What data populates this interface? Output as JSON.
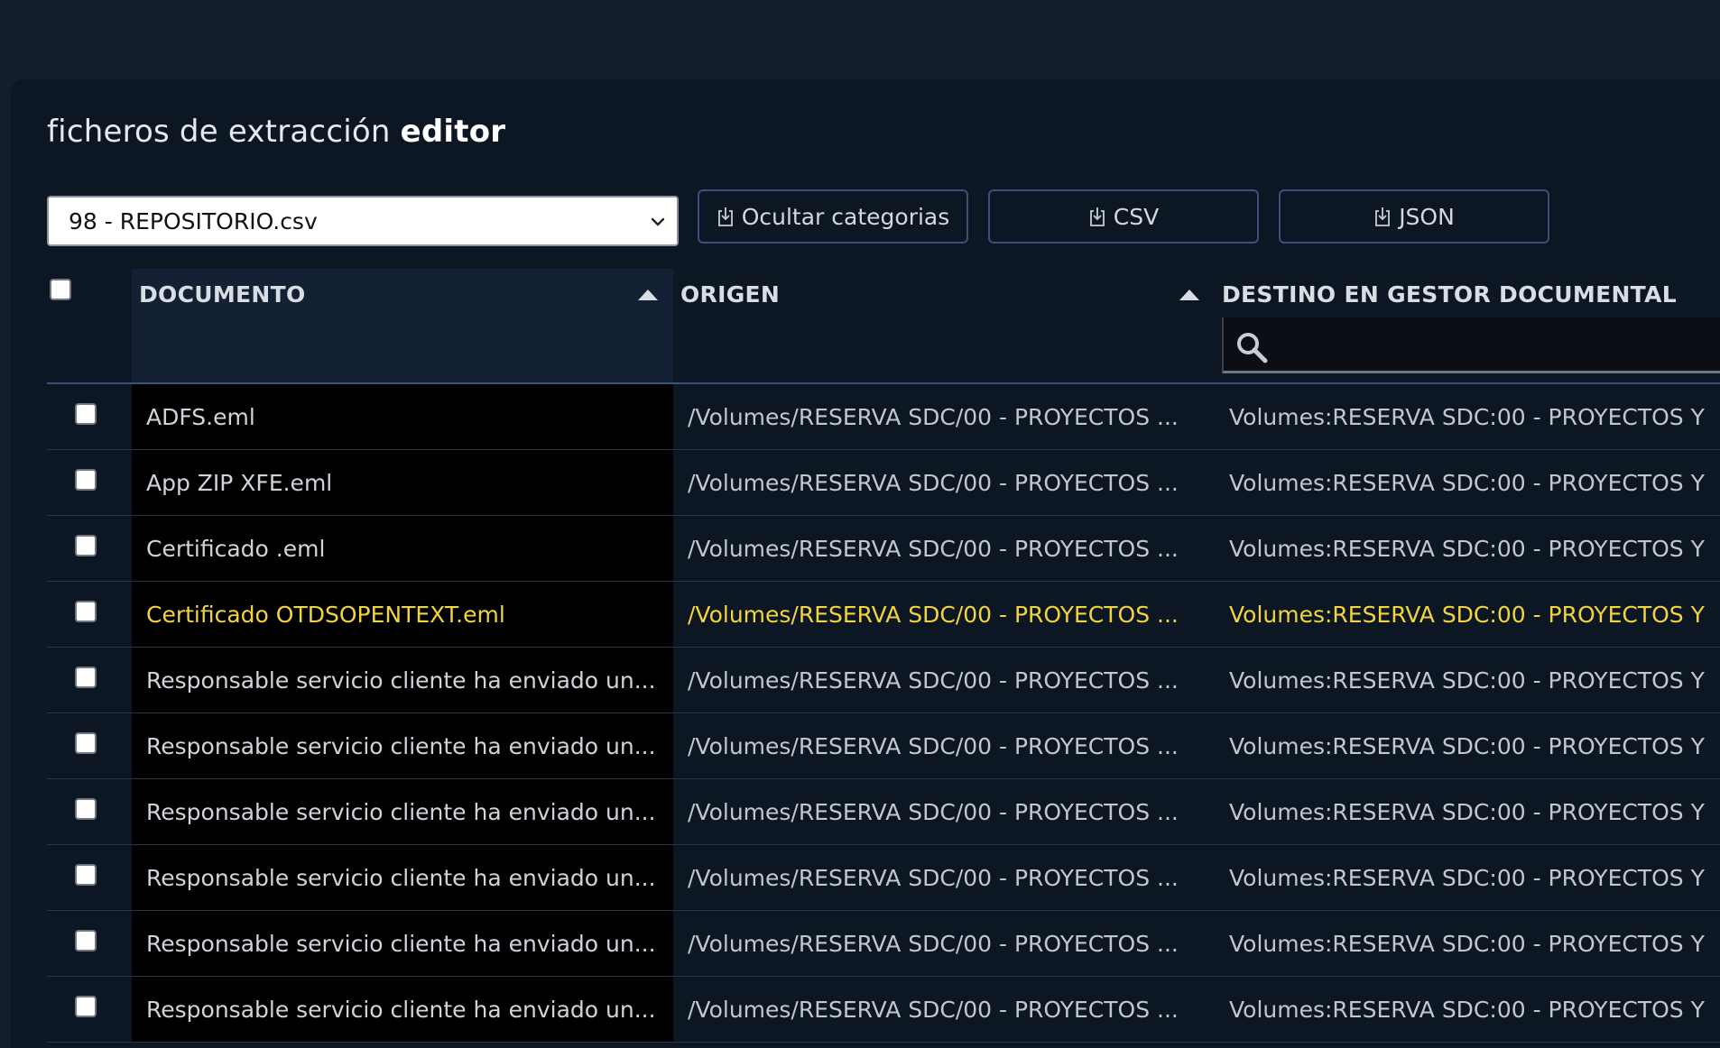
{
  "page": {
    "title_prefix": "ficheros de extracción",
    "title_bold": "editor"
  },
  "toolbar": {
    "file_select_value": "98 - REPOSITORIO.csv",
    "hide_categories_label": "Ocultar categorias",
    "csv_label": "CSV",
    "json_label": "JSON"
  },
  "table": {
    "columns": {
      "documento": "DOCUMENTO",
      "origen": "ORIGEN",
      "destino": "DESTINO EN GESTOR DOCUMENTAL"
    },
    "sort": {
      "documento": "ascending",
      "origen": "ascending"
    },
    "search_placeholder": "",
    "rows": [
      {
        "documento": "ADFS.eml",
        "origen": "/Volumes/RESERVA SDC/00 - PROYECTOS ...",
        "destino": "Volumes:RESERVA SDC:00 - PROYECTOS Y",
        "highlighted": false
      },
      {
        "documento": "App ZIP XFE.eml",
        "origen": "/Volumes/RESERVA SDC/00 - PROYECTOS ...",
        "destino": "Volumes:RESERVA SDC:00 - PROYECTOS Y",
        "highlighted": false
      },
      {
        "documento": "Certificado .eml",
        "origen": "/Volumes/RESERVA SDC/00 - PROYECTOS ...",
        "destino": "Volumes:RESERVA SDC:00 - PROYECTOS Y",
        "highlighted": false
      },
      {
        "documento": "Certificado OTDSOPENTEXT.eml",
        "origen": "/Volumes/RESERVA SDC/00 - PROYECTOS ...",
        "destino": "Volumes:RESERVA SDC:00 - PROYECTOS Y",
        "highlighted": true
      },
      {
        "documento": "Responsable servicio cliente ha enviado un...",
        "origen": "/Volumes/RESERVA SDC/00 - PROYECTOS ...",
        "destino": "Volumes:RESERVA SDC:00 - PROYECTOS Y",
        "highlighted": false
      },
      {
        "documento": "Responsable servicio cliente ha enviado un...",
        "origen": "/Volumes/RESERVA SDC/00 - PROYECTOS ...",
        "destino": "Volumes:RESERVA SDC:00 - PROYECTOS Y",
        "highlighted": false
      },
      {
        "documento": "Responsable servicio cliente ha enviado un...",
        "origen": "/Volumes/RESERVA SDC/00 - PROYECTOS ...",
        "destino": "Volumes:RESERVA SDC:00 - PROYECTOS Y",
        "highlighted": false
      },
      {
        "documento": "Responsable servicio cliente ha enviado un...",
        "origen": "/Volumes/RESERVA SDC/00 - PROYECTOS ...",
        "destino": "Volumes:RESERVA SDC:00 - PROYECTOS Y",
        "highlighted": false
      },
      {
        "documento": "Responsable servicio cliente ha enviado un...",
        "origen": "/Volumes/RESERVA SDC/00 - PROYECTOS ...",
        "destino": "Volumes:RESERVA SDC:00 - PROYECTOS Y",
        "highlighted": false
      },
      {
        "documento": "Responsable servicio cliente ha enviado un...",
        "origen": "/Volumes/RESERVA SDC/00 - PROYECTOS ...",
        "destino": "Volumes:RESERVA SDC:00 - PROYECTOS Y",
        "highlighted": false
      }
    ]
  },
  "colors": {
    "background": "#131d2c",
    "panel": "#0d1623",
    "button_border": "#3d4f7a",
    "highlight_text": "#f2d43c"
  },
  "icons": {
    "download": "download-icon",
    "search": "search-icon",
    "sort": "sort-ascending-icon",
    "select": "chevron-down-icon"
  }
}
